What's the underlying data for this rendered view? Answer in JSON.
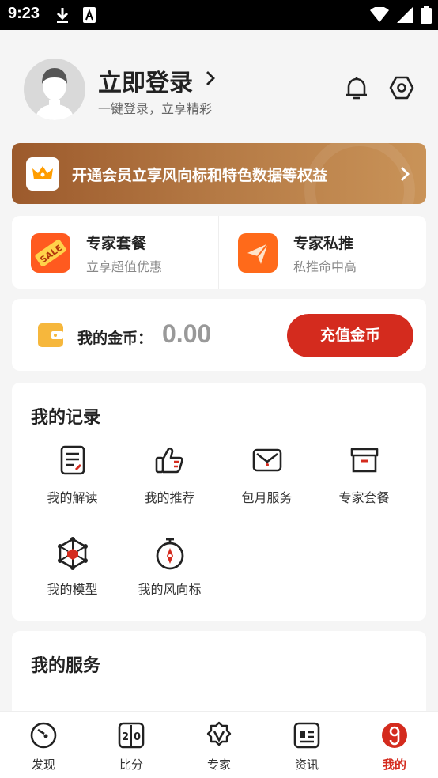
{
  "status_bar": {
    "time": "9:23"
  },
  "header": {
    "login_title": "立即登录",
    "login_subtitle": "一键登录，立享精彩"
  },
  "vip_banner": {
    "text": "开通会员立享风向标和特色数据等权益"
  },
  "packages": [
    {
      "title": "专家套餐",
      "subtitle": "立享超值优惠",
      "icon": "sale-tag-icon"
    },
    {
      "title": "专家私推",
      "subtitle": "私推命中高",
      "icon": "paper-plane-icon"
    }
  ],
  "coins": {
    "label": "我的金币：",
    "value": "0.00",
    "button": "充值金币"
  },
  "records": {
    "title": "我的记录",
    "items": [
      {
        "label": "我的解读",
        "icon": "document-icon"
      },
      {
        "label": "我的推荐",
        "icon": "thumbs-up-icon"
      },
      {
        "label": "包月服务",
        "icon": "envelope-icon"
      },
      {
        "label": "专家套餐",
        "icon": "box-icon"
      },
      {
        "label": "我的模型",
        "icon": "molecule-icon"
      },
      {
        "label": "我的风向标",
        "icon": "stopwatch-icon"
      }
    ]
  },
  "services": {
    "title": "我的服务"
  },
  "tabbar": {
    "items": [
      {
        "label": "发现",
        "icon": "compass-icon",
        "active": false
      },
      {
        "label": "比分",
        "icon": "score-icon",
        "active": false
      },
      {
        "label": "专家",
        "icon": "expert-badge-icon",
        "active": false
      },
      {
        "label": "资讯",
        "icon": "news-icon",
        "active": false
      },
      {
        "label": "我的",
        "icon": "profile-icon",
        "active": true
      }
    ]
  },
  "colors": {
    "accent": "#d42b1e",
    "vip_gold": "#b57a45",
    "package_orange": "#ff5a1f"
  }
}
